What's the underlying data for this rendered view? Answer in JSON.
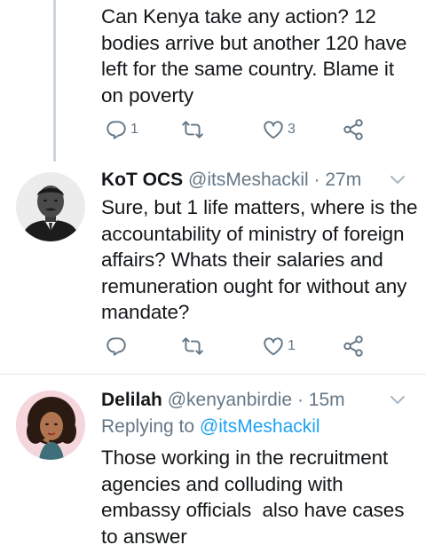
{
  "tweets": [
    {
      "text_lines": [
        "Can Kenya take any action? 12",
        "bodies arrive but another 120 have",
        "left for the same country. Blame it",
        "on poverty"
      ],
      "actions": {
        "reply_count": "1",
        "retweet_count": "",
        "like_count": "3"
      }
    },
    {
      "name": "KoT OCS",
      "handle": "@itsMeshackil",
      "time": "· 27m",
      "text_lines": [
        "Sure, but 1 life matters, where is the",
        "accountability of ministry of foreign",
        "affairs? Whats their salaries and",
        "remuneration ought for without any",
        "mandate?"
      ],
      "actions": {
        "reply_count": "",
        "retweet_count": "",
        "like_count": "1"
      }
    },
    {
      "name": "Delilah",
      "handle": "@kenyanbirdie",
      "time": "· 15m",
      "replying_prefix": "Replying to",
      "replying_to": "@itsMeshackil",
      "text_lines": [
        "Those working in the recruitment",
        "agencies and colluding with",
        "embassy officials  also have cases",
        "to answer"
      ]
    }
  ],
  "icons": {
    "reply": "reply-icon",
    "retweet": "retweet-icon",
    "like": "heart-icon",
    "share": "share-icon",
    "more": "chevron-down-icon"
  },
  "colors": {
    "text": "#14171a",
    "secondary": "#657786",
    "link": "#1da1f2",
    "divider": "#e1e8ed"
  }
}
